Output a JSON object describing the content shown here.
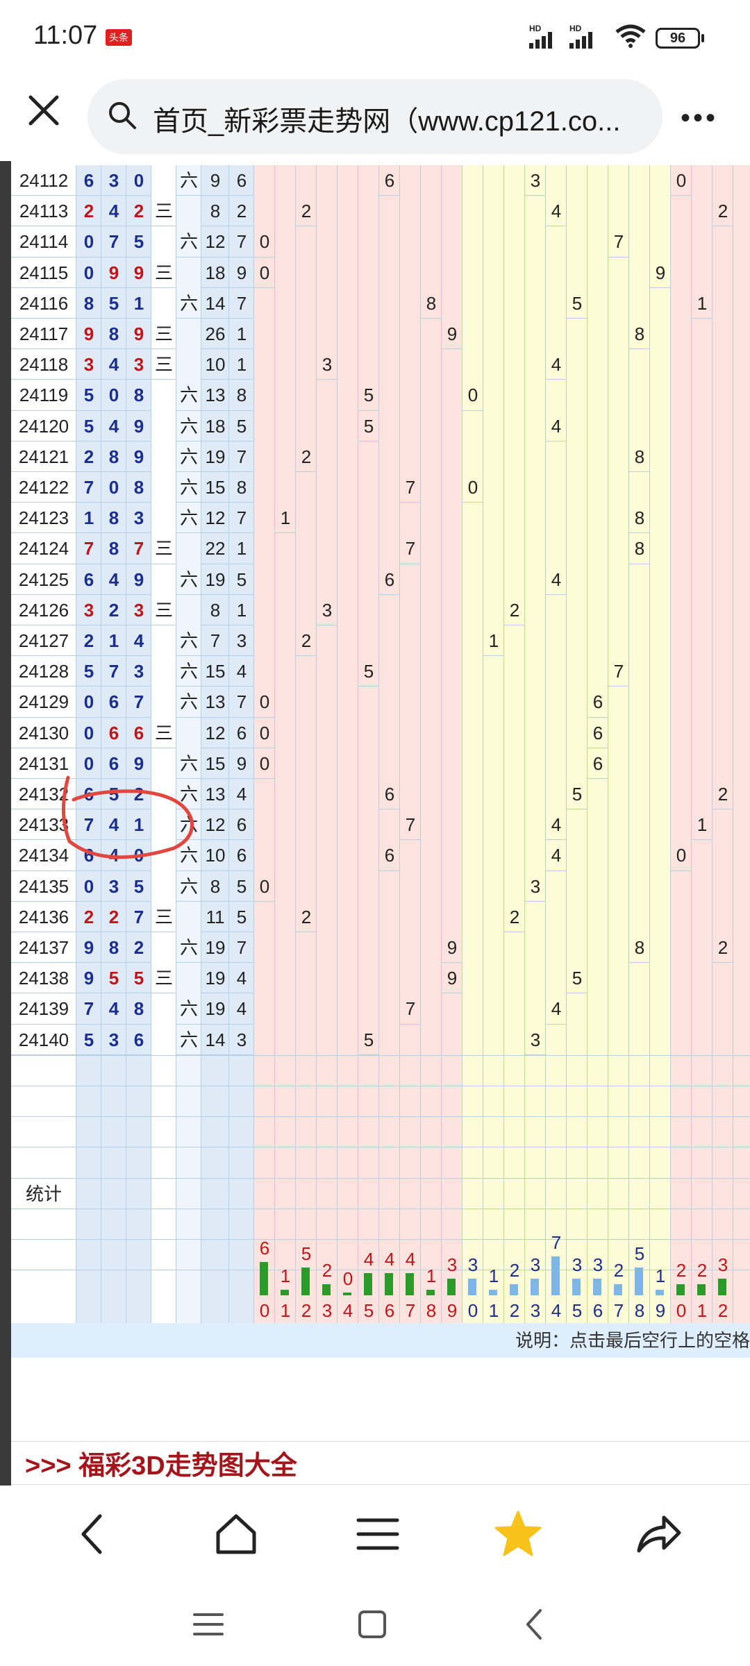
{
  "status_bar": {
    "time": "11:07",
    "app_badge": "头条",
    "signal_1": "HD",
    "signal_2": "HD",
    "battery": "96",
    "icons": [
      "signal-icon",
      "signal-icon",
      "wifi-icon",
      "battery-icon"
    ]
  },
  "address_bar": {
    "title": "首页_新彩票走势网（www.cp121.co...",
    "icons": [
      "close-icon",
      "search-icon",
      "more-icon"
    ]
  },
  "colors": {
    "blue_band": "#dfeaf7",
    "pink_band": "#fde3de",
    "yellow_band": "#fdfcd6",
    "red_digit": "#c0141a",
    "blue_digit": "#1b2d8f",
    "green_bar": "#2a9a2a",
    "blue_bar": "#7fb6e8"
  },
  "draws": [
    {
      "issue": "24112",
      "digits": [
        "6",
        "3",
        "0"
      ],
      "group": "六",
      "sum": "9",
      "span": "6",
      "hundreds": "6",
      "tens": "3",
      "units": "0"
    },
    {
      "issue": "24113",
      "digits": [
        "2",
        "4",
        "2"
      ],
      "group": "三",
      "sum": "8",
      "span": "2",
      "hundreds": "2",
      "tens": "4",
      "units": "2"
    },
    {
      "issue": "24114",
      "digits": [
        "0",
        "7",
        "5"
      ],
      "group": "六",
      "sum": "12",
      "span": "7",
      "hundreds": "0",
      "tens": "7",
      "units": ""
    },
    {
      "issue": "24115",
      "digits": [
        "0",
        "9",
        "9"
      ],
      "group": "三",
      "sum": "18",
      "span": "9",
      "hundreds": "0",
      "tens": "9",
      "units": ""
    },
    {
      "issue": "24116",
      "digits": [
        "8",
        "5",
        "1"
      ],
      "group": "六",
      "sum": "14",
      "span": "7",
      "hundreds": "8",
      "tens": "5",
      "units": "1"
    },
    {
      "issue": "24117",
      "digits": [
        "9",
        "8",
        "9"
      ],
      "group": "三",
      "sum": "26",
      "span": "1",
      "hundreds": "9",
      "tens": "8",
      "units": ""
    },
    {
      "issue": "24118",
      "digits": [
        "3",
        "4",
        "3"
      ],
      "group": "三",
      "sum": "10",
      "span": "1",
      "hundreds": "3",
      "tens": "4",
      "units": ""
    },
    {
      "issue": "24119",
      "digits": [
        "5",
        "0",
        "8"
      ],
      "group": "六",
      "sum": "13",
      "span": "8",
      "hundreds": "5",
      "tens": "0",
      "units": ""
    },
    {
      "issue": "24120",
      "digits": [
        "5",
        "4",
        "9"
      ],
      "group": "六",
      "sum": "18",
      "span": "5",
      "hundreds": "5",
      "tens": "4",
      "units": ""
    },
    {
      "issue": "24121",
      "digits": [
        "2",
        "8",
        "9"
      ],
      "group": "六",
      "sum": "19",
      "span": "7",
      "hundreds": "2",
      "tens": "8",
      "units": ""
    },
    {
      "issue": "24122",
      "digits": [
        "7",
        "0",
        "8"
      ],
      "group": "六",
      "sum": "15",
      "span": "8",
      "hundreds": "7",
      "tens": "0",
      "units": ""
    },
    {
      "issue": "24123",
      "digits": [
        "1",
        "8",
        "3"
      ],
      "group": "六",
      "sum": "12",
      "span": "7",
      "hundreds": "1",
      "tens": "8",
      "units": ""
    },
    {
      "issue": "24124",
      "digits": [
        "7",
        "8",
        "7"
      ],
      "group": "三",
      "sum": "22",
      "span": "1",
      "hundreds": "7",
      "tens": "8",
      "units": ""
    },
    {
      "issue": "24125",
      "digits": [
        "6",
        "4",
        "9"
      ],
      "group": "六",
      "sum": "19",
      "span": "5",
      "hundreds": "6",
      "tens": "4",
      "units": ""
    },
    {
      "issue": "24126",
      "digits": [
        "3",
        "2",
        "3"
      ],
      "group": "三",
      "sum": "8",
      "span": "1",
      "hundreds": "3",
      "tens": "2",
      "units": ""
    },
    {
      "issue": "24127",
      "digits": [
        "2",
        "1",
        "4"
      ],
      "group": "六",
      "sum": "7",
      "span": "3",
      "hundreds": "2",
      "tens": "1",
      "units": ""
    },
    {
      "issue": "24128",
      "digits": [
        "5",
        "7",
        "3"
      ],
      "group": "六",
      "sum": "15",
      "span": "4",
      "hundreds": "5",
      "tens": "7",
      "units": ""
    },
    {
      "issue": "24129",
      "digits": [
        "0",
        "6",
        "7"
      ],
      "group": "六",
      "sum": "13",
      "span": "7",
      "hundreds": "0",
      "tens": "6",
      "units": ""
    },
    {
      "issue": "24130",
      "digits": [
        "0",
        "6",
        "6"
      ],
      "group": "三",
      "sum": "12",
      "span": "6",
      "hundreds": "0",
      "tens": "6",
      "units": ""
    },
    {
      "issue": "24131",
      "digits": [
        "0",
        "6",
        "9"
      ],
      "group": "六",
      "sum": "15",
      "span": "9",
      "hundreds": "0",
      "tens": "6",
      "units": ""
    },
    {
      "issue": "24132",
      "digits": [
        "6",
        "5",
        "2"
      ],
      "group": "六",
      "sum": "13",
      "span": "4",
      "hundreds": "6",
      "tens": "5",
      "units": "2"
    },
    {
      "issue": "24133",
      "digits": [
        "7",
        "4",
        "1"
      ],
      "group": "六",
      "sum": "12",
      "span": "6",
      "hundreds": "7",
      "tens": "4",
      "units": "1"
    },
    {
      "issue": "24134",
      "digits": [
        "6",
        "4",
        "0"
      ],
      "group": "六",
      "sum": "10",
      "span": "6",
      "hundreds": "6",
      "tens": "4",
      "units": "0"
    },
    {
      "issue": "24135",
      "digits": [
        "0",
        "3",
        "5"
      ],
      "group": "六",
      "sum": "8",
      "span": "5",
      "hundreds": "0",
      "tens": "3",
      "units": ""
    },
    {
      "issue": "24136",
      "digits": [
        "2",
        "2",
        "7"
      ],
      "group": "三",
      "sum": "11",
      "span": "5",
      "hundreds": "2",
      "tens": "2",
      "units": ""
    },
    {
      "issue": "24137",
      "digits": [
        "9",
        "8",
        "2"
      ],
      "group": "六",
      "sum": "19",
      "span": "7",
      "hundreds": "9",
      "tens": "8",
      "units": "2"
    },
    {
      "issue": "24138",
      "digits": [
        "9",
        "5",
        "5"
      ],
      "group": "三",
      "sum": "19",
      "span": "4",
      "hundreds": "9",
      "tens": "5",
      "units": ""
    },
    {
      "issue": "24139",
      "digits": [
        "7",
        "4",
        "8"
      ],
      "group": "六",
      "sum": "19",
      "span": "4",
      "hundreds": "7",
      "tens": "4",
      "units": ""
    },
    {
      "issue": "24140",
      "digits": [
        "5",
        "3",
        "6"
      ],
      "group": "六",
      "sum": "14",
      "span": "3",
      "hundreds": "5",
      "tens": "3",
      "units": ""
    }
  ],
  "stats": {
    "label": "统计",
    "axis_labels": [
      "0",
      "1",
      "2",
      "3",
      "4",
      "5",
      "6",
      "7",
      "8",
      "9",
      "0",
      "1",
      "2",
      "3",
      "4",
      "5",
      "6",
      "7",
      "8",
      "9",
      "0",
      "1",
      "2"
    ]
  },
  "chart_data": {
    "type": "bar",
    "title": "",
    "categories": [
      "0",
      "1",
      "2",
      "3",
      "4",
      "5",
      "6",
      "7",
      "8",
      "9",
      "0",
      "1",
      "2",
      "3",
      "4",
      "5",
      "6",
      "7",
      "8",
      "9",
      "0",
      "1",
      "2"
    ],
    "series": [
      {
        "values": [
          6,
          1,
          5,
          2,
          0,
          4,
          4,
          4,
          1,
          3,
          3,
          1,
          2,
          3,
          7,
          3,
          3,
          2,
          5,
          1,
          2,
          2,
          3
        ]
      }
    ],
    "xlabel": "",
    "ylabel": ""
  },
  "notes": {
    "explain": "说明：点击最后空行上的空格"
  },
  "link": {
    "label": ">>> 福彩3D走势图大全"
  },
  "nav": {
    "icons": [
      "back-icon",
      "home-icon",
      "menu-icon",
      "star-icon",
      "share-icon"
    ]
  },
  "system_nav": {
    "icons": [
      "recents-icon",
      "home-square-icon",
      "back-triangle-icon"
    ]
  }
}
